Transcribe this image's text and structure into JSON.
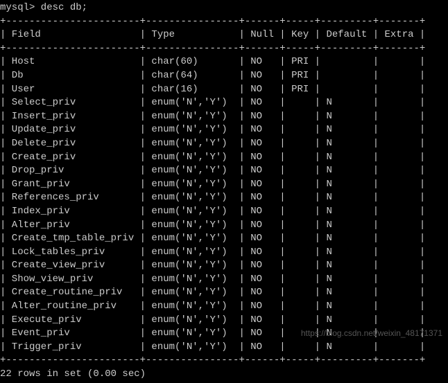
{
  "prompt": "mysql> desc db;",
  "headers": {
    "field": "Field",
    "type": "Type",
    "null": "Null",
    "key": "Key",
    "default": "Default",
    "extra": "Extra"
  },
  "rows": [
    {
      "field": "Host",
      "type": "char(60)",
      "null": "NO",
      "key": "PRI",
      "default": "",
      "extra": ""
    },
    {
      "field": "Db",
      "type": "char(64)",
      "null": "NO",
      "key": "PRI",
      "default": "",
      "extra": ""
    },
    {
      "field": "User",
      "type": "char(16)",
      "null": "NO",
      "key": "PRI",
      "default": "",
      "extra": ""
    },
    {
      "field": "Select_priv",
      "type": "enum('N','Y')",
      "null": "NO",
      "key": "",
      "default": "N",
      "extra": ""
    },
    {
      "field": "Insert_priv",
      "type": "enum('N','Y')",
      "null": "NO",
      "key": "",
      "default": "N",
      "extra": ""
    },
    {
      "field": "Update_priv",
      "type": "enum('N','Y')",
      "null": "NO",
      "key": "",
      "default": "N",
      "extra": ""
    },
    {
      "field": "Delete_priv",
      "type": "enum('N','Y')",
      "null": "NO",
      "key": "",
      "default": "N",
      "extra": ""
    },
    {
      "field": "Create_priv",
      "type": "enum('N','Y')",
      "null": "NO",
      "key": "",
      "default": "N",
      "extra": ""
    },
    {
      "field": "Drop_priv",
      "type": "enum('N','Y')",
      "null": "NO",
      "key": "",
      "default": "N",
      "extra": ""
    },
    {
      "field": "Grant_priv",
      "type": "enum('N','Y')",
      "null": "NO",
      "key": "",
      "default": "N",
      "extra": ""
    },
    {
      "field": "References_priv",
      "type": "enum('N','Y')",
      "null": "NO",
      "key": "",
      "default": "N",
      "extra": ""
    },
    {
      "field": "Index_priv",
      "type": "enum('N','Y')",
      "null": "NO",
      "key": "",
      "default": "N",
      "extra": ""
    },
    {
      "field": "Alter_priv",
      "type": "enum('N','Y')",
      "null": "NO",
      "key": "",
      "default": "N",
      "extra": ""
    },
    {
      "field": "Create_tmp_table_priv",
      "type": "enum('N','Y')",
      "null": "NO",
      "key": "",
      "default": "N",
      "extra": ""
    },
    {
      "field": "Lock_tables_priv",
      "type": "enum('N','Y')",
      "null": "NO",
      "key": "",
      "default": "N",
      "extra": ""
    },
    {
      "field": "Create_view_priv",
      "type": "enum('N','Y')",
      "null": "NO",
      "key": "",
      "default": "N",
      "extra": ""
    },
    {
      "field": "Show_view_priv",
      "type": "enum('N','Y')",
      "null": "NO",
      "key": "",
      "default": "N",
      "extra": ""
    },
    {
      "field": "Create_routine_priv",
      "type": "enum('N','Y')",
      "null": "NO",
      "key": "",
      "default": "N",
      "extra": ""
    },
    {
      "field": "Alter_routine_priv",
      "type": "enum('N','Y')",
      "null": "NO",
      "key": "",
      "default": "N",
      "extra": ""
    },
    {
      "field": "Execute_priv",
      "type": "enum('N','Y')",
      "null": "NO",
      "key": "",
      "default": "N",
      "extra": ""
    },
    {
      "field": "Event_priv",
      "type": "enum('N','Y')",
      "null": "NO",
      "key": "",
      "default": "N",
      "extra": ""
    },
    {
      "field": "Trigger_priv",
      "type": "enum('N','Y')",
      "null": "NO",
      "key": "",
      "default": "N",
      "extra": ""
    }
  ],
  "summary": "22 rows in set (0.00 sec)",
  "watermark": "https://blog.csdn.net/weixin_48171371",
  "col_widths": {
    "field": 23,
    "type": 16,
    "null": 6,
    "key": 5,
    "default": 9,
    "extra": 7
  }
}
